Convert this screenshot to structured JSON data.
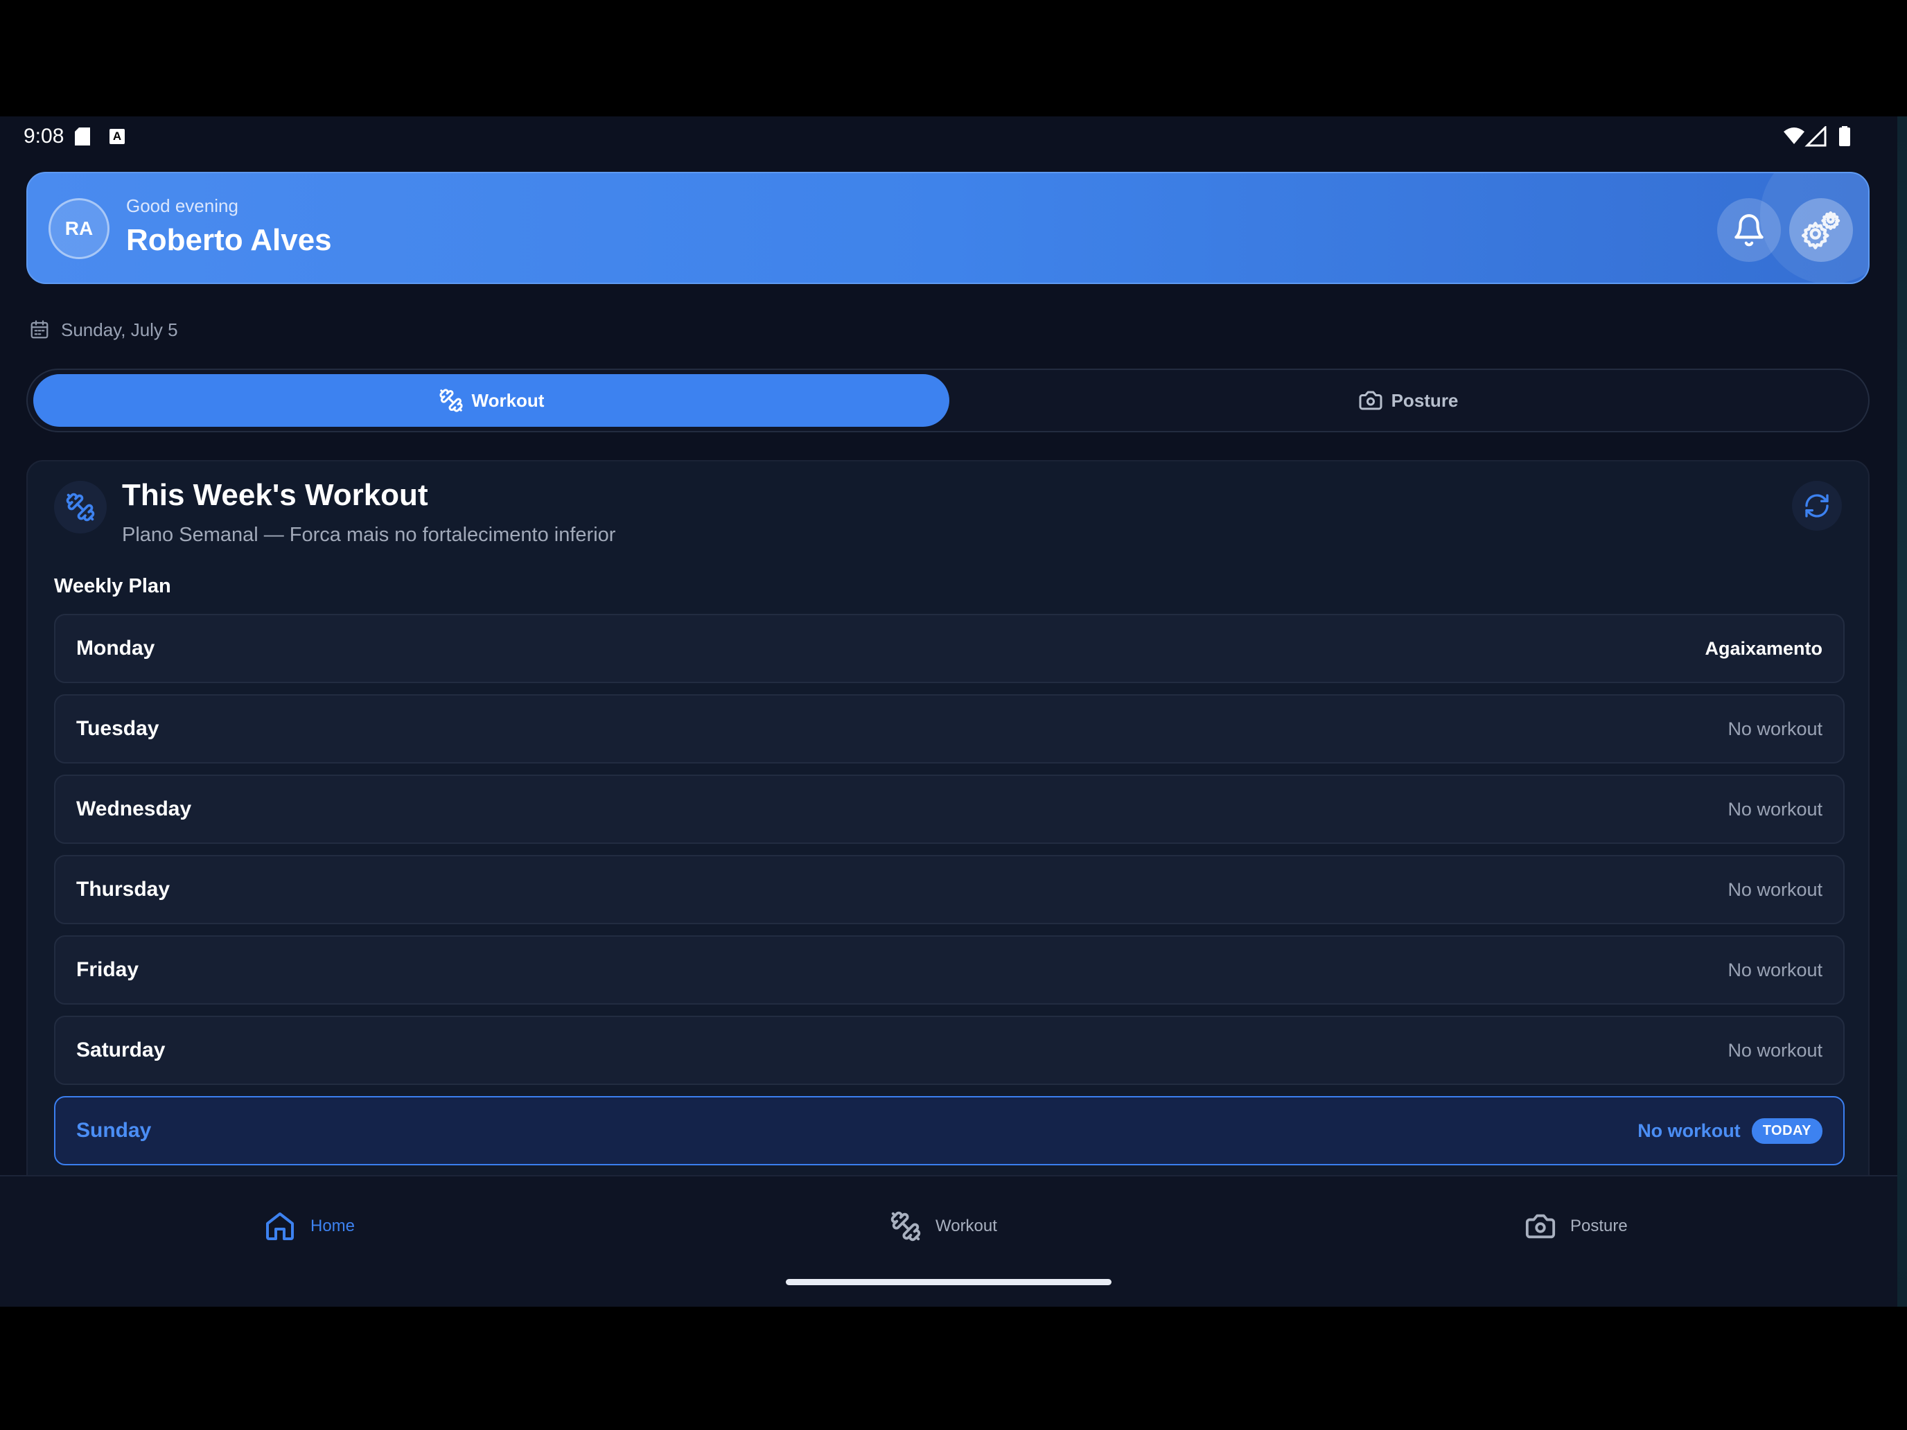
{
  "status_bar": {
    "time": "9:08",
    "icons": [
      "sd-card-icon",
      "a-badge-icon",
      "wifi-icon",
      "signal-icon",
      "battery-icon"
    ]
  },
  "header": {
    "avatar_initials": "RA",
    "greeting": "Good evening",
    "user_name": "Roberto Alves",
    "icons": [
      "bell-icon",
      "gear-icon"
    ]
  },
  "date_label": "Sunday, July 5",
  "segment_tabs": [
    {
      "label": "Workout",
      "icon": "dumbbell-icon",
      "selected": true
    },
    {
      "label": "Posture",
      "icon": "camera-icon",
      "selected": false
    }
  ],
  "workout_card": {
    "title": "This Week's Workout",
    "subtitle": "Plano Semanal — Forca mais no fortalecimento inferior",
    "section_label": "Weekly Plan",
    "days": [
      {
        "day": "Monday",
        "plan": "Agaixamento"
      },
      {
        "day": "Tuesday",
        "plan": "No workout"
      },
      {
        "day": "Wednesday",
        "plan": "No workout"
      },
      {
        "day": "Thursday",
        "plan": "No workout"
      },
      {
        "day": "Friday",
        "plan": "No workout"
      },
      {
        "day": "Saturday",
        "plan": "No workout"
      },
      {
        "day": "Sunday",
        "plan": "No workout",
        "badge": "TODAY"
      }
    ]
  },
  "bottom_nav": [
    {
      "label": "Home",
      "icon": "home-icon",
      "active": true
    },
    {
      "label": "Workout",
      "icon": "dumbbell-icon",
      "active": false
    },
    {
      "label": "Posture",
      "icon": "camera-icon",
      "active": false
    }
  ],
  "colors": {
    "accent": "#3d82f0",
    "background": "#0c1120",
    "card": "#111a2c"
  }
}
